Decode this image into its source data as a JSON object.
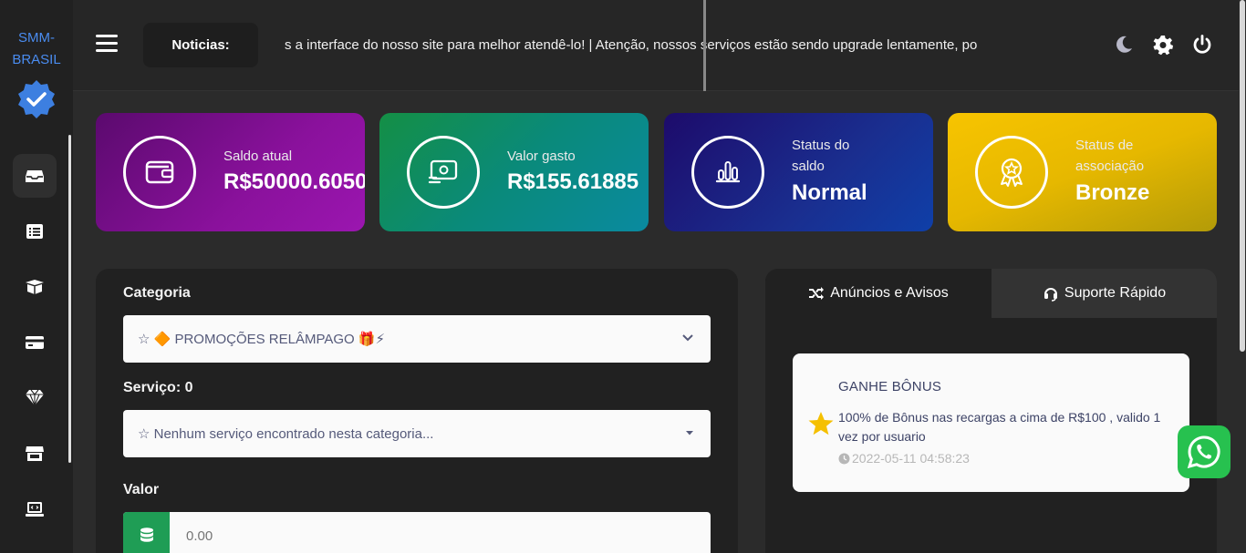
{
  "brand": {
    "line1": "SMM-",
    "line2": "BRASIL"
  },
  "sidebar": {
    "items": [
      {
        "icon": "inbox-icon",
        "active": true
      },
      {
        "icon": "list-icon"
      },
      {
        "icon": "box-icon"
      },
      {
        "icon": "credit-card-icon"
      },
      {
        "icon": "diamond-icon"
      },
      {
        "icon": "store-icon"
      },
      {
        "icon": "laptop-code-icon"
      }
    ]
  },
  "topbar": {
    "news_label": "Noticias:",
    "news_text": "s a interface do nosso site para melhor atendê-lo! | Atenção, nossos serviços estão sendo upgrade lentamente, po"
  },
  "cards": {
    "balance": {
      "label": "Saldo atual",
      "value": "R$50000.6050"
    },
    "spent": {
      "label": "Valor gasto",
      "value": "R$155.61885"
    },
    "status": {
      "label_line1": "Status do",
      "label_line2": "saldo",
      "value": "Normal"
    },
    "membership": {
      "label_line1": "Status de",
      "label_line2": "associação",
      "value": "Bronze"
    }
  },
  "order": {
    "category_label": "Categoria",
    "category_value": "☆ 🔶 PROMOÇÕES RELÂMPAGO 🎁⚡",
    "service_label": "Serviço: 0",
    "service_value": "☆ Nenhum serviço encontrado nesta categoria...",
    "amount_label": "Valor",
    "amount_placeholder": "0.00"
  },
  "announcements": {
    "tab1": "Anúncios e Avisos",
    "tab2": "Suporte Rápido",
    "notice": {
      "title": "GANHE BÔNUS",
      "body": "100% de Bônus nas recargas a cima de R$100 , valido 1 vez por usuario",
      "date": "2022-05-11 04:58:23"
    }
  },
  "colors": {
    "accent_blue": "#4a8cf0",
    "whatsapp": "#27c14f",
    "amount_icon_bg": "#1f9d55"
  }
}
